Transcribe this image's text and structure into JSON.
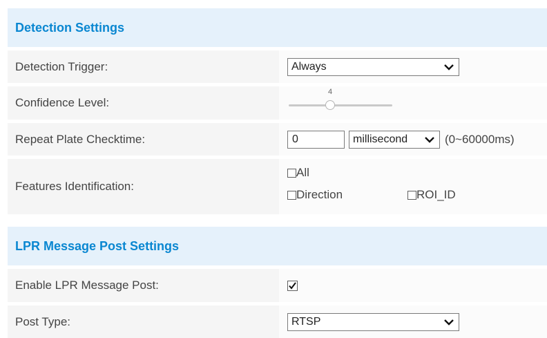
{
  "detection": {
    "title": "Detection Settings",
    "trigger": {
      "label": "Detection Trigger:",
      "value": "Always"
    },
    "confidence": {
      "label": "Confidence Level:",
      "value": "4",
      "level_fraction": 0.4
    },
    "repeat": {
      "label": "Repeat Plate Checktime:",
      "value": "0",
      "unit": "millisecond",
      "range": "(0~60000ms)"
    },
    "features": {
      "label": "Features Identification:",
      "options": [
        {
          "label": "All",
          "checked": false
        },
        {
          "label": "Direction",
          "checked": false
        },
        {
          "label": "ROI_ID",
          "checked": false
        }
      ]
    }
  },
  "lpr": {
    "title": "LPR Message Post Settings",
    "enable": {
      "label": "Enable LPR Message Post:",
      "checked": true
    },
    "post_type": {
      "label": "Post Type:",
      "value": "RTSP"
    }
  },
  "colors": {
    "header_bg": "#e5f1fb",
    "header_text": "#0a87d1",
    "row_bg": "#f5f5f5"
  },
  "icons": {
    "dropdown": "chevron-down-icon",
    "check": "checkmark-icon"
  }
}
